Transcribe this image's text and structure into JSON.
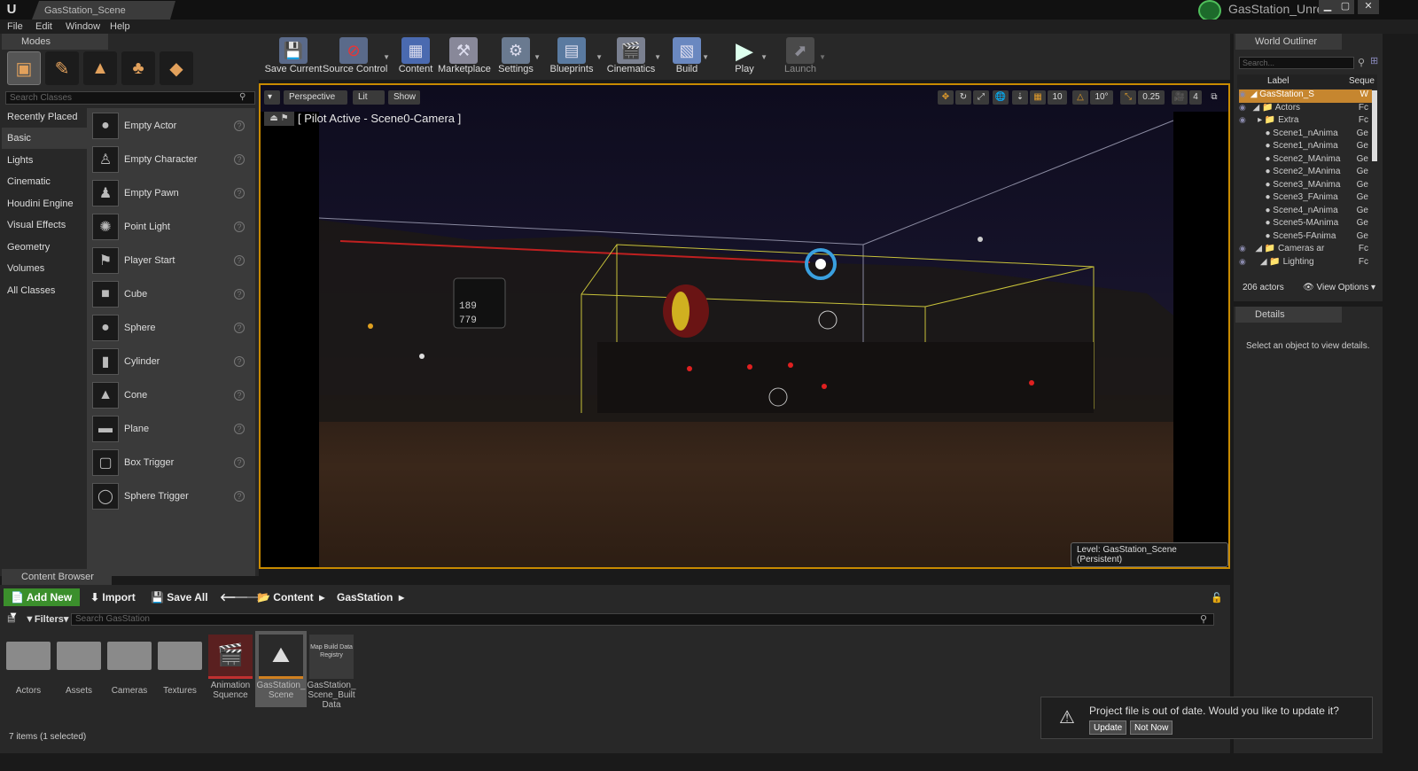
{
  "app": {
    "doc_tab": "GasStation_Scene",
    "project": "GasStation_Unreal",
    "logo": "U"
  },
  "window": {
    "minimize": "▁",
    "maximize": "▢",
    "close": "✕"
  },
  "menu": [
    "File",
    "Edit",
    "Window",
    "Help"
  ],
  "modes": {
    "tab": "Modes",
    "search_placeholder": "Search Classes",
    "categories": [
      "Recently Placed",
      "Basic",
      "Lights",
      "Cinematic",
      "Houdini Engine",
      "Visual Effects",
      "Geometry",
      "Volumes",
      "All Classes"
    ],
    "active_category": "Basic",
    "items": [
      "Empty Actor",
      "Empty Character",
      "Empty Pawn",
      "Point Light",
      "Player Start",
      "Cube",
      "Sphere",
      "Cylinder",
      "Cone",
      "Plane",
      "Box Trigger",
      "Sphere Trigger"
    ]
  },
  "toolbar": [
    "Save Current",
    "Source Control",
    "Content",
    "Marketplace",
    "Settings",
    "Blueprints",
    "Cinematics",
    "Build",
    "Play",
    "Launch"
  ],
  "viewport": {
    "perspective": "Perspective",
    "lit": "Lit",
    "show": "Show",
    "pilot": "[ Pilot Active - Scene0-Camera ]",
    "level_label": "Level:  GasStation_Scene (Persistent)",
    "grid": "10",
    "angle": "10°",
    "scale": "0.25",
    "cam_speed": "4",
    "sign_top": "189",
    "sign_bottom": "779"
  },
  "outliner": {
    "tab": "World Outliner",
    "search_placeholder": "Search...",
    "col_label": "Label",
    "col_type": "Seque",
    "count": "206 actors",
    "view_options": "View Options",
    "rows": [
      {
        "label": "GasStation_S",
        "type": "W"
      },
      {
        "label": "Actors",
        "type": "Fc"
      },
      {
        "label": "Extra",
        "type": "Fc"
      },
      {
        "label": "Scene1_nAnima",
        "type": "Ge"
      },
      {
        "label": "Scene1_nAnima",
        "type": "Ge"
      },
      {
        "label": "Scene2_MAnima",
        "type": "Ge"
      },
      {
        "label": "Scene2_MAnima",
        "type": "Ge"
      },
      {
        "label": "Scene3_MAnima",
        "type": "Ge"
      },
      {
        "label": "Scene3_FAnima",
        "type": "Ge"
      },
      {
        "label": "Scene4_nAnima",
        "type": "Ge"
      },
      {
        "label": "Scene5-MAnima",
        "type": "Ge"
      },
      {
        "label": "Scene5-FAnima",
        "type": "Ge"
      },
      {
        "label": "Cameras ar",
        "type": "Fc"
      },
      {
        "label": "Lighting",
        "type": "Fc"
      }
    ]
  },
  "details": {
    "tab": "Details",
    "empty": "Select an object to view details."
  },
  "content_browser": {
    "tab": "Content Browser",
    "add_new": "Add New",
    "import": "Import",
    "save_all": "Save All",
    "path": [
      "Content",
      "GasStation"
    ],
    "filters": "Filters",
    "search_placeholder": "Search GasStation",
    "items_count": "7 items (1 selected)",
    "assets": [
      "Actors",
      "Assets",
      "Cameras",
      "Textures",
      "Animation Squence",
      "GasStation_ Scene",
      "GasStation_ Scene_Built Data"
    ],
    "registry_thumb": "Map Build Data Registry"
  },
  "toast": {
    "message": "Project file is out of date. Would you like to update it?",
    "update": "Update",
    "not_now": "Not Now"
  }
}
